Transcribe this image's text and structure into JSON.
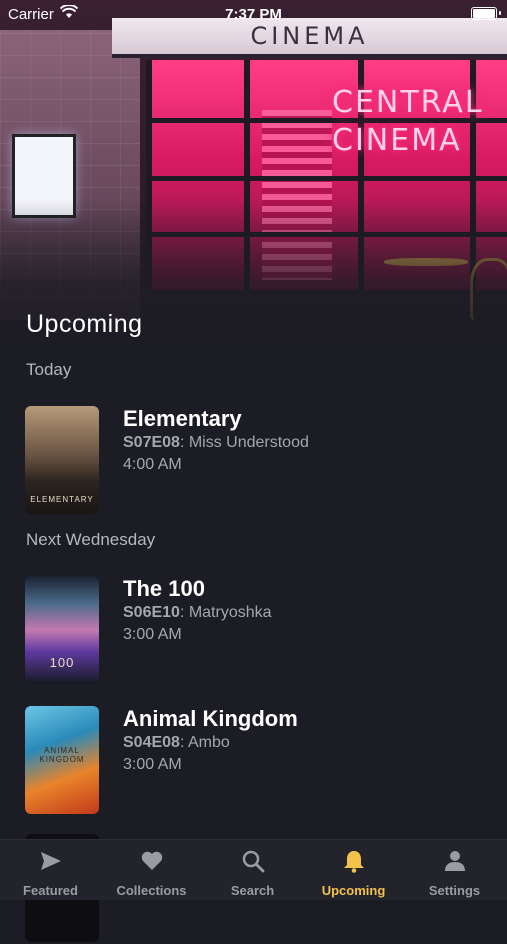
{
  "status_bar": {
    "carrier": "Carrier",
    "time": "7:37 PM"
  },
  "hero": {
    "sign_text": "CINEMA",
    "neon_line1": "CENTRAL",
    "neon_line2": "CINEMA"
  },
  "page": {
    "title": "Upcoming"
  },
  "sections": [
    {
      "label": "Today",
      "items": [
        {
          "title": "Elementary",
          "episode_code": "S07E08",
          "episode_name": ": Miss Understood",
          "time": "4:00 AM",
          "poster_text": "ELEMENTARY"
        }
      ]
    },
    {
      "label": "Next Wednesday",
      "items": [
        {
          "title": "The 100",
          "episode_code": "S06E10",
          "episode_name": ": Matryoshka",
          "time": "3:00 AM",
          "poster_text": "100"
        },
        {
          "title": "Animal Kingdom",
          "episode_code": "S04E08",
          "episode_name": ": Ambo",
          "time": "3:00 AM",
          "poster_text": "ANIMAL KINGDOM"
        }
      ]
    }
  ],
  "tabs": [
    {
      "label": "Featured",
      "icon": "paper-plane-icon",
      "active": false
    },
    {
      "label": "Collections",
      "icon": "heart-icon",
      "active": false
    },
    {
      "label": "Search",
      "icon": "search-icon",
      "active": false
    },
    {
      "label": "Upcoming",
      "icon": "bell-icon",
      "active": true
    },
    {
      "label": "Settings",
      "icon": "person-icon",
      "active": false
    }
  ],
  "colors": {
    "accent": "#f2c24b",
    "background": "#1c1c24",
    "tab_inactive": "#9b9ba4"
  }
}
